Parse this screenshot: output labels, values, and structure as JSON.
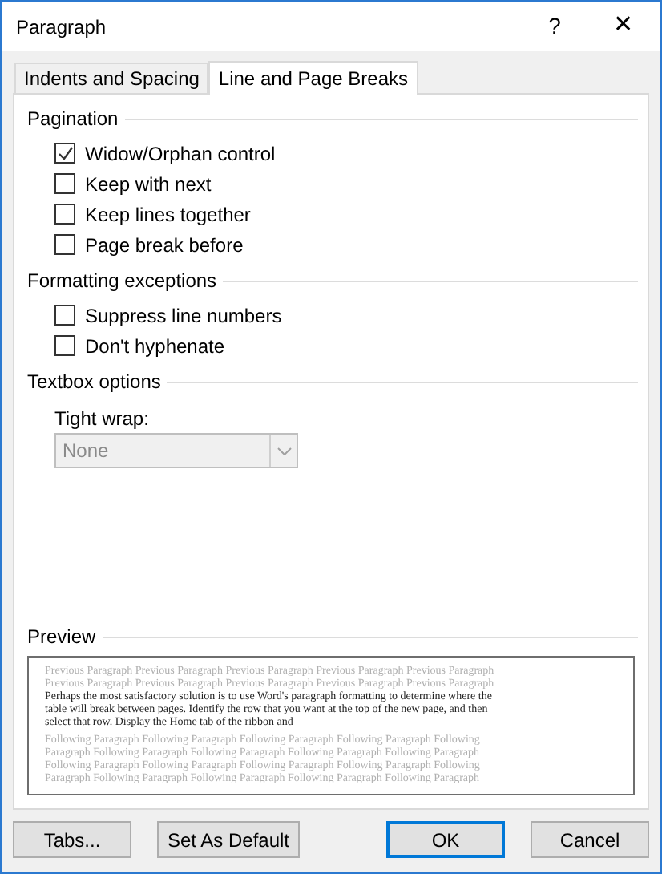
{
  "window": {
    "title": "Paragraph",
    "help": "?",
    "close": "✕"
  },
  "tabs": [
    {
      "label": "Indents and Spacing",
      "selected": false
    },
    {
      "label": "Line and Page Breaks",
      "selected": true
    }
  ],
  "sections": [
    {
      "title": "Pagination",
      "items": [
        {
          "kind": "checkbox",
          "label": "Widow/Orphan control",
          "checked": true
        },
        {
          "kind": "checkbox",
          "label": "Keep with next",
          "checked": false
        },
        {
          "kind": "checkbox",
          "label": "Keep lines together",
          "checked": false
        },
        {
          "kind": "checkbox",
          "label": "Page break before",
          "checked": false
        }
      ]
    },
    {
      "title": "Formatting exceptions",
      "items": [
        {
          "kind": "checkbox",
          "label": "Suppress line numbers",
          "checked": false
        },
        {
          "kind": "checkbox",
          "label": "Don't hyphenate",
          "checked": false
        }
      ]
    },
    {
      "title": "Textbox options",
      "items": [
        {
          "kind": "dropdown",
          "label": "Tight wrap:",
          "value": "None",
          "disabled": true
        }
      ]
    }
  ],
  "preview": {
    "title": "Preview",
    "previous": [
      "Previous Paragraph Previous Paragraph Previous Paragraph Previous Paragraph Previous Paragraph",
      "Previous Paragraph Previous Paragraph Previous Paragraph Previous Paragraph Previous Paragraph"
    ],
    "current": [
      "Perhaps the most satisfactory solution is to use Word's paragraph formatting to determine where the",
      "table will break between pages. Identify the row that you want at the top of the new page, and then",
      "select that row. Display the Home tab of the ribbon and"
    ],
    "following": [
      "Following Paragraph Following Paragraph Following Paragraph Following Paragraph Following",
      "Paragraph Following Paragraph Following Paragraph Following Paragraph Following Paragraph",
      "Following Paragraph Following Paragraph Following Paragraph Following Paragraph Following",
      "Paragraph Following Paragraph Following Paragraph Following Paragraph Following Paragraph"
    ]
  },
  "buttons": [
    {
      "label": "Tabs...",
      "kind": "normal"
    },
    {
      "label": "Set As Default",
      "kind": "normal"
    },
    {
      "label": "OK",
      "kind": "default"
    },
    {
      "label": "Cancel",
      "kind": "normal"
    }
  ]
}
